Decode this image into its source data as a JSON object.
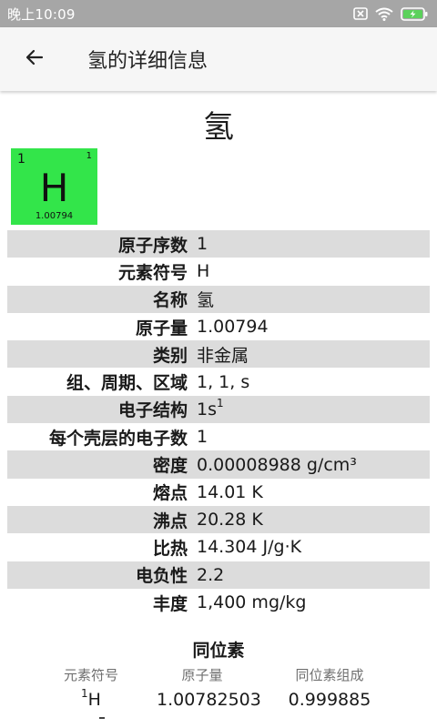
{
  "status_bar": {
    "time": "晚上10:09",
    "icons": [
      "sim-off-icon",
      "wifi-icon",
      "battery-charging-icon"
    ],
    "background_color": "#a6a6a6"
  },
  "app_bar": {
    "back_icon": "arrow-left-icon",
    "title": "氢的详细信息"
  },
  "element": {
    "name": "氢",
    "tile": {
      "atomic_number_left": "1",
      "atomic_number_right": "1",
      "symbol": "H",
      "atomic_mass": "1.00794",
      "color": "#33e54a"
    }
  },
  "properties": [
    {
      "label": "原子序数",
      "value": "1"
    },
    {
      "label": "元素符号",
      "value": "H"
    },
    {
      "label": "名称",
      "value": "氢"
    },
    {
      "label": "原子量",
      "value": "1.00794"
    },
    {
      "label": "类别",
      "value": "非金属"
    },
    {
      "label": "组、周期、区域",
      "value": "1, 1, s"
    },
    {
      "label": "电子结构",
      "value": "1s",
      "value_sup": "1"
    },
    {
      "label": "每个壳层的电子数",
      "value": "1"
    },
    {
      "label": "密度",
      "value": "0.00008988 g/cm³"
    },
    {
      "label": "熔点",
      "value": "14.01 K"
    },
    {
      "label": "沸点",
      "value": "20.28 K"
    },
    {
      "label": "比热",
      "value": "14.304 J/g·K"
    },
    {
      "label": "电负性",
      "value": "2.2"
    },
    {
      "label": "丰度",
      "value": "1,400 mg/kg"
    }
  ],
  "row_shade_color": "#dcdcdc",
  "isotopes": {
    "title": "同位素",
    "headers": [
      "元素符号",
      "原子量",
      "同位素组成"
    ],
    "rows": [
      {
        "mass_number": "1",
        "symbol": "H",
        "atomic_mass": "1.00782503",
        "composition": "0.999885"
      }
    ]
  }
}
